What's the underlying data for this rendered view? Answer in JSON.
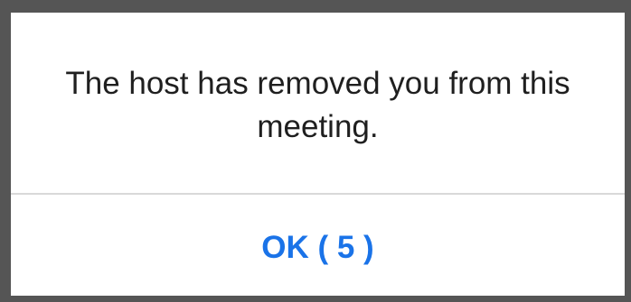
{
  "dialog": {
    "message": "The host has removed you from this meeting.",
    "ok_label": "OK ( 5 )"
  },
  "colors": {
    "accent": "#1a73e8",
    "backdrop": "#555555",
    "dialog_background": "#ffffff",
    "divider": "#d9d9d9",
    "text": "#1f1f1f"
  }
}
